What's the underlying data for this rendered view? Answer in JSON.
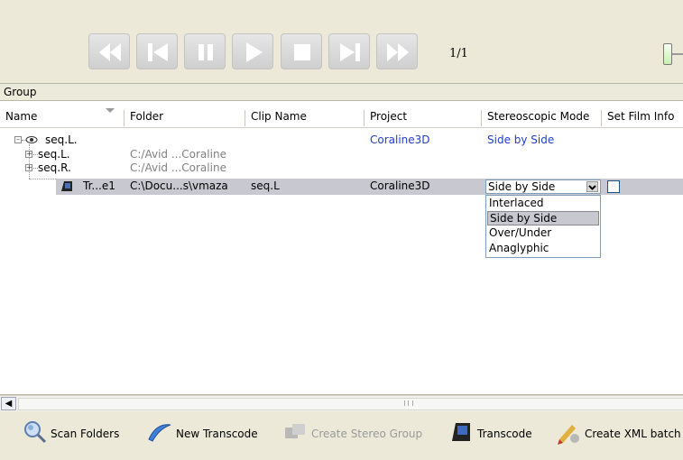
{
  "transport": {
    "buttons": [
      "rewind",
      "previous",
      "pause",
      "play",
      "stop",
      "next",
      "fast-forward"
    ],
    "counter": "1/1"
  },
  "group_header": "Group",
  "columns": [
    "Name",
    "Folder",
    "Clip Name",
    "Project",
    "Stereoscopic Mode",
    "Set Film Info"
  ],
  "rows": [
    {
      "name": "seq.L.",
      "folder": "",
      "clip": "",
      "project": "Coraline3D",
      "mode": "Side by Side"
    },
    {
      "name": "seq.L.",
      "folder": "C:/Avid ...Coraline",
      "clip": "",
      "project": "",
      "mode": ""
    },
    {
      "name": "seq.R.",
      "folder": "C:/Avid ...Coraline",
      "clip": "",
      "project": "",
      "mode": ""
    },
    {
      "name": "Tr...e1",
      "folder": "C:\\Docu...s\\vmaza",
      "clip": "seq.L",
      "project": "Coraline3D",
      "mode": "Side by Side"
    }
  ],
  "dropdown": {
    "selected": "Side by Side",
    "options": [
      "Interlaced",
      "Side by Side",
      "Over/Under",
      "Anaglyphic"
    ]
  },
  "toolbar": {
    "scan": "Scan Folders",
    "new_transcode": "New Transcode",
    "create_stereo": "Create Stereo Group",
    "transcode": "Transcode",
    "create_xml": "Create XML batch"
  },
  "colors": {
    "link_blue": "#1f3ec9",
    "selection": "#c8c8d0",
    "chrome": "#ece9d8"
  }
}
